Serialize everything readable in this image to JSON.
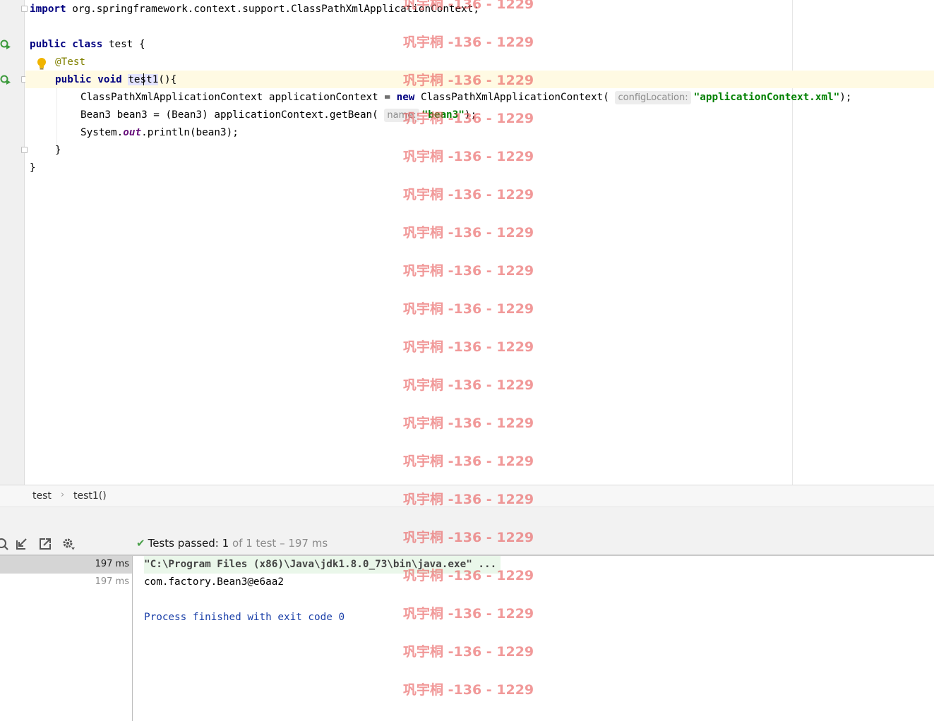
{
  "editor": {
    "lines": {
      "import": {
        "kw": "import",
        "rest": " org.springframework.context.support.ClassPathXmlApplicationContext;"
      },
      "class_decl": {
        "kw1": "public",
        "kw2": "class",
        "rest": " test {"
      },
      "annotation": "@Test",
      "method_decl": {
        "kw1": "public",
        "kw2": "void",
        "name": "test1",
        "rest": "(){"
      },
      "line_ctx": {
        "part1": "ClassPathXmlApplicationContext applicationContext = ",
        "kw_new": "new",
        "part2": " ClassPathXmlApplicationContext(",
        "hint": "configLocation:",
        "string": "\"applicationContext.xml\"",
        "end": ");"
      },
      "line_bean": {
        "part1": "Bean3 bean3 = (Bean3) applicationContext.getBean(",
        "hint": "name:",
        "string": "\"bean3\"",
        "end": ");"
      },
      "line_print": {
        "part1": "System.",
        "field": "out",
        "part2": ".println(bean3);"
      },
      "close_method": "}",
      "close_class": "}"
    }
  },
  "breadcrumb": {
    "items": [
      "test",
      "test1()"
    ],
    "separator": "›"
  },
  "run_panel": {
    "status": {
      "label": "Tests passed:",
      "count": "1",
      "detail": "of 1 test – 197 ms"
    },
    "tree": [
      {
        "duration": "197 ms",
        "selected": true
      },
      {
        "duration": "197 ms",
        "selected": false
      }
    ],
    "console": {
      "command": "\"C:\\Program Files (x86)\\Java\\jdk1.8.0_73\\bin\\java.exe\" ...",
      "output": "com.factory.Bean3@e6aa2",
      "exit": "Process finished with exit code 0"
    },
    "toolbar_icons": [
      "search-icon",
      "import-icon",
      "export-icon",
      "gear-icon"
    ]
  },
  "watermark": {
    "text": "巩宇桐 -136 - 1229",
    "color": "#e85a5a"
  }
}
